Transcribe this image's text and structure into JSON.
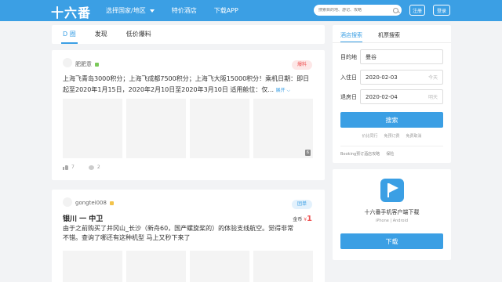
{
  "header": {
    "logo": "十六番",
    "nav": [
      {
        "label": "选择国家/地区"
      },
      {
        "label": "特价酒店"
      },
      {
        "label": "下载APP"
      }
    ],
    "search_placeholder": "搜索目的地、游记、攻略",
    "register_label": "注册",
    "login_label": "登录"
  },
  "feed_tabs": [
    {
      "label": "D 圈",
      "active": true
    },
    {
      "label": "发现",
      "active": false
    },
    {
      "label": "低价爆料",
      "active": false
    }
  ],
  "posts": [
    {
      "username": "肥肥意",
      "level_color": "#7bc95a",
      "badge": "爆料",
      "text": "上海飞青岛3000积分；上海飞成都7500积分；上海飞大阪15000积分！乘机日期：即日起至2020年1月15日，2020年2月10日至2020年3月10日 适用舱位：仅...",
      "more_label": "展开",
      "image_count": "6",
      "likes": "7",
      "comments": "2"
    },
    {
      "username": "gongtei008",
      "level_color": "#f3c34a",
      "badge": "团单",
      "title": "银川 一 中卫",
      "price_prefix": "金币",
      "price_currency": "¥",
      "price_value": "1",
      "text": "由于之前购买了井冈山_长沙（新舟60，国产螺旋桨的）的体验支线航空。觉得非常不错。查询了哪还有这种机型 马上又秒下来了"
    }
  ],
  "hotel_search": {
    "tabs": [
      {
        "label": "酒店搜索",
        "active": true
      },
      {
        "label": "机票搜索",
        "active": false
      }
    ],
    "destination_label": "目的地",
    "destination_value": "曼谷",
    "checkin_label": "入住日",
    "checkin_value": "2020-02-03",
    "checkin_day": "今天",
    "checkout_label": "退房日",
    "checkout_value": "2020-02-04",
    "checkout_day": "明天",
    "search_label": "搜索",
    "links": [
      "价比同行",
      "免预订费",
      "免费取消"
    ],
    "links2": [
      "Booking预订酒店攻略",
      "保险"
    ]
  },
  "app_promo": {
    "title": "十六番手机客户端下载",
    "platforms": "iPhone | Android",
    "download_label": "下载"
  }
}
